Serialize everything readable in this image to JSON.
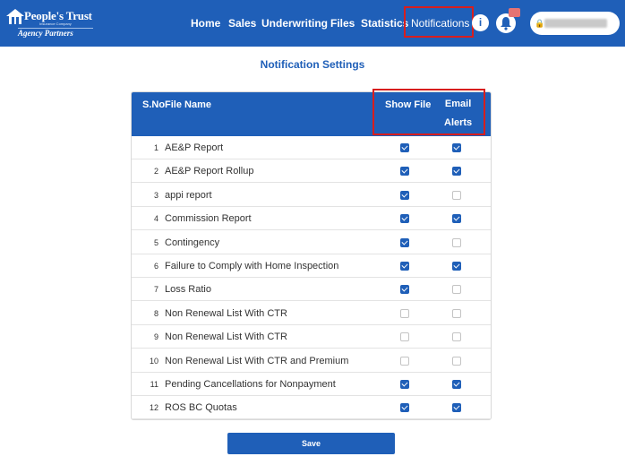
{
  "header": {
    "brand": "People's Trust",
    "tagline": "Insurance Company",
    "sub_brand": "Agency Partners",
    "nav": [
      "Home",
      "Sales",
      "Underwriting",
      "Files",
      "Statistics",
      "Notifications"
    ],
    "active_nav": "Notifications",
    "info_label": "i",
    "lock_icon": "lock-icon"
  },
  "page": {
    "title": "Notification Settings",
    "columns": {
      "sno": "S.No",
      "file_name": "File Name",
      "show_file": "Show File",
      "email_alerts_1": "Email",
      "email_alerts_2": "Alerts"
    },
    "rows": [
      {
        "sno": "1",
        "name": "AE&P Report",
        "show": true,
        "email": true
      },
      {
        "sno": "2",
        "name": "AE&P Report Rollup",
        "show": true,
        "email": true
      },
      {
        "sno": "3",
        "name": "appi report",
        "show": true,
        "email": false
      },
      {
        "sno": "4",
        "name": "Commission Report",
        "show": true,
        "email": true
      },
      {
        "sno": "5",
        "name": "Contingency",
        "show": true,
        "email": false
      },
      {
        "sno": "6",
        "name": "Failure to Comply with Home Inspection",
        "show": true,
        "email": true
      },
      {
        "sno": "7",
        "name": "Loss Ratio",
        "show": true,
        "email": false
      },
      {
        "sno": "8",
        "name": "Non Renewal List With CTR",
        "show": false,
        "email": false
      },
      {
        "sno": "9",
        "name": "Non Renewal List With CTR",
        "show": false,
        "email": false
      },
      {
        "sno": "10",
        "name": "Non Renewal List With CTR and Premium",
        "show": false,
        "email": false
      },
      {
        "sno": "11",
        "name": "Pending Cancellations for Nonpayment",
        "show": true,
        "email": true
      },
      {
        "sno": "12",
        "name": "ROS BC Quotas",
        "show": true,
        "email": true
      }
    ],
    "save_label": "Save"
  },
  "colors": {
    "primary": "#1f5fb8",
    "highlight": "#d81e1e"
  }
}
